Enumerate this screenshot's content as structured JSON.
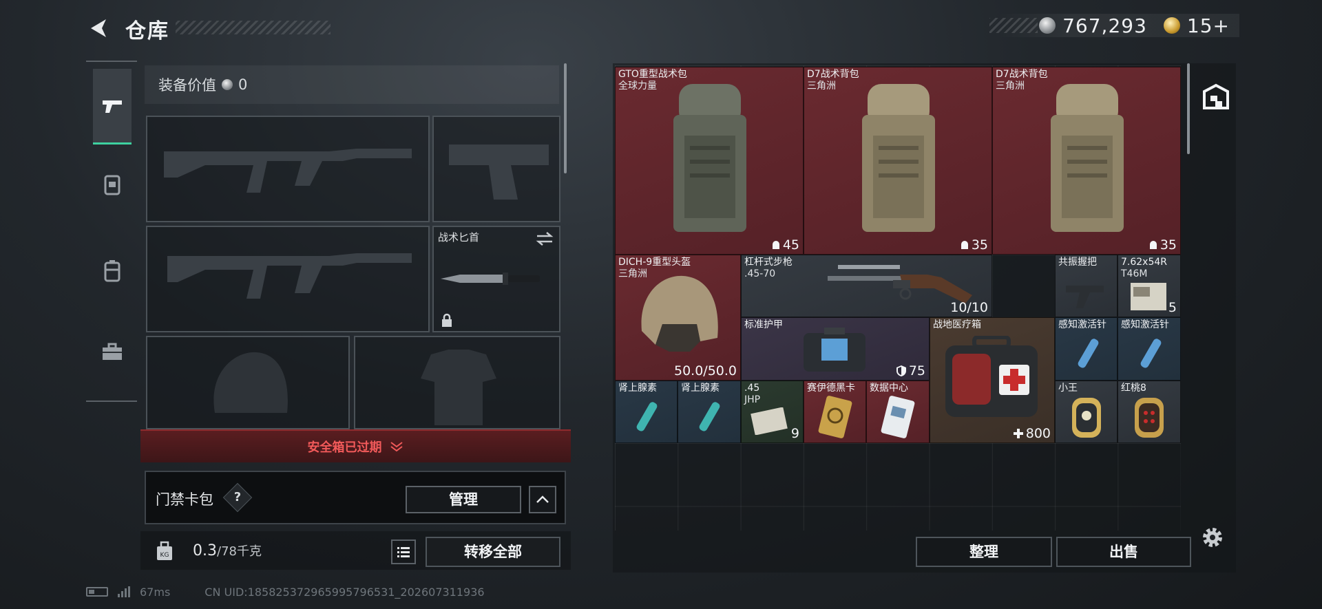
{
  "header": {
    "title": "仓库",
    "silver": "767,293",
    "gold": "15+"
  },
  "sidebar": {
    "tabs": [
      {
        "id": "weapons",
        "icon": "pistol-icon"
      },
      {
        "id": "equipment",
        "icon": "vest-icon"
      },
      {
        "id": "backpack",
        "icon": "backpack-icon"
      },
      {
        "id": "toolbox",
        "icon": "toolbox-icon"
      }
    ]
  },
  "loadout": {
    "value_label": "装备价值",
    "value": "0",
    "melee_label": "战术匕首",
    "safebox_status": "安全箱已过期",
    "keycard_label": "门禁卡包",
    "help": "?",
    "manage_label": "管理",
    "weight_value": "0.3",
    "weight_max": "/78千克",
    "transfer_label": "转移全部"
  },
  "stash": {
    "sort_label": "整理",
    "sell_label": "出售",
    "items": [
      {
        "name": "GTO重型战术包",
        "sub": "全球力量",
        "count": "45"
      },
      {
        "name": "D7战术背包",
        "sub": "三角洲",
        "count": "35"
      },
      {
        "name": "D7战术背包",
        "sub": "三角洲",
        "count": "35"
      },
      {
        "name": "DICH-9重型头盔",
        "sub": "三角洲",
        "count": "50.0/50.0"
      },
      {
        "name": "杠杆式步枪",
        "sub": ".45-70",
        "count": "10/10"
      },
      {
        "name": "共振握把",
        "sub": "",
        "count": ""
      },
      {
        "name": "7.62x54R",
        "sub": "T46M",
        "count": "5"
      },
      {
        "name": "标准护甲",
        "sub": "",
        "count": "75"
      },
      {
        "name": "战地医疗箱",
        "sub": "",
        "count": "800"
      },
      {
        "name": "感知激活针",
        "sub": "",
        "count": ""
      },
      {
        "name": "感知激活针",
        "sub": "",
        "count": ""
      },
      {
        "name": "肾上腺素",
        "sub": "",
        "count": ""
      },
      {
        "name": "肾上腺素",
        "sub": "",
        "count": ""
      },
      {
        "name": ".45",
        "sub": "JHP",
        "count": "9"
      },
      {
        "name": "赛伊德黑卡",
        "sub": "",
        "count": ""
      },
      {
        "name": "数据中心",
        "sub": "",
        "count": ""
      },
      {
        "name": "小王",
        "sub": "",
        "count": ""
      },
      {
        "name": "红桃8",
        "sub": "",
        "count": ""
      }
    ]
  },
  "status": {
    "ping": "67ms",
    "uid": "CN UID:185825372965995796531_202607311936"
  },
  "colors": {
    "accent": "#3ed1a0",
    "danger": "#f25a5a",
    "item_red": "#6a2a30",
    "item_blue": "#293846"
  }
}
